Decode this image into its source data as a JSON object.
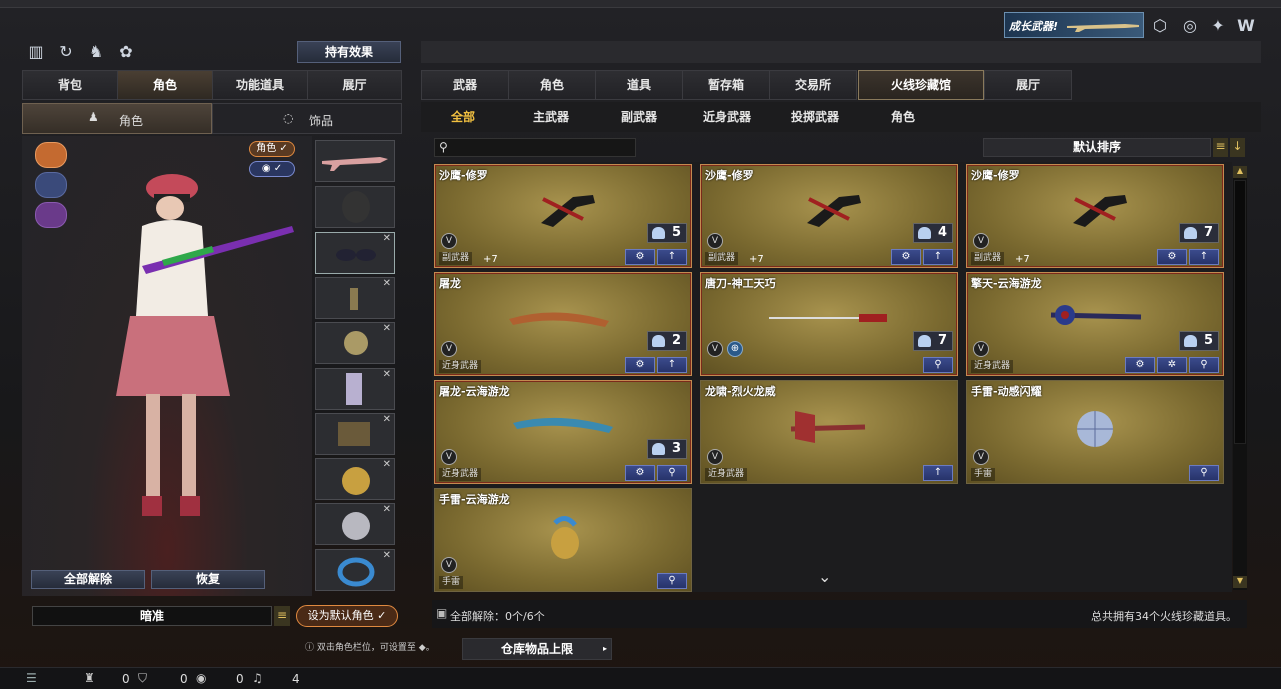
{
  "top_right": {
    "banner": "成长武器!"
  },
  "left": {
    "hold_effect_btn": "持有效果",
    "tabs": [
      "背包",
      "角色",
      "功能道具",
      "展厅"
    ],
    "subtabs": [
      "角色",
      "饰品"
    ],
    "role_toggle": "角色",
    "release_all": "全部解除",
    "restore": "恢复",
    "char_name": "暗准",
    "set_default": "设为默认角色"
  },
  "right": {
    "tabs": [
      "武器",
      "角色",
      "道具",
      "暂存箱",
      "交易所",
      "火线珍藏馆",
      "展厅"
    ],
    "subtabs": [
      "全部",
      "主武器",
      "副武器",
      "近身武器",
      "投掷武器",
      "角色"
    ],
    "sort": "默认排序",
    "cards": [
      {
        "name": "沙鹰-修罗",
        "cat": "副武器",
        "lv": "+7",
        "count": "5"
      },
      {
        "name": "沙鹰-修罗",
        "cat": "副武器",
        "lv": "+7",
        "count": "4"
      },
      {
        "name": "沙鹰-修罗",
        "cat": "副武器",
        "lv": "+7",
        "count": "7"
      },
      {
        "name": "屠龙",
        "cat": "近身武器",
        "count": "2"
      },
      {
        "name": "唐刀-神工天巧",
        "cat": "",
        "count": "7"
      },
      {
        "name": "擎天-云海游龙",
        "cat": "近身武器",
        "count": "5"
      },
      {
        "name": "屠龙-云海游龙",
        "cat": "近身武器",
        "count": "3"
      },
      {
        "name": "龙啸-烈火龙威",
        "cat": "近身武器"
      },
      {
        "name": "手雷-动感闪耀",
        "cat": "手雷"
      },
      {
        "name": "手雷-云海游龙",
        "cat": "手雷"
      }
    ],
    "footer_left": "全部解除：0个/6个",
    "footer_right": "总共拥有34个火线珍藏道具。"
  },
  "bottom": {
    "hint": "双击角色栏位，可设置至",
    "hint_tail": "。",
    "storage_btn": "仓库物品上限",
    "c1": "0",
    "c2": "0",
    "c3": "4"
  },
  "colors": {
    "accent": "#c38a50",
    "card_gold": "#8a7838",
    "blue_btn": "#3b4b8c"
  }
}
